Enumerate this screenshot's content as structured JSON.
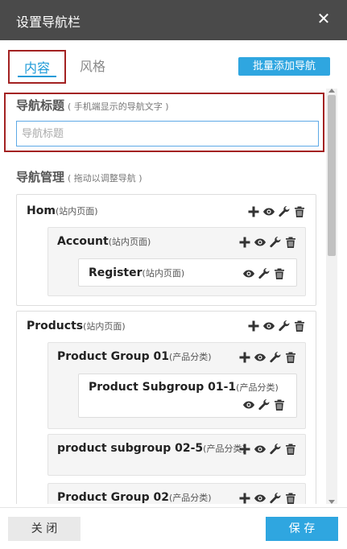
{
  "dialog": {
    "title": "设置导航栏",
    "close_glyph": "✕"
  },
  "tabs": [
    {
      "label": "内容",
      "active": true
    },
    {
      "label": "风格",
      "active": false
    }
  ],
  "batch_add_label": "批量添加导航",
  "nav_title": {
    "label": "导航标题",
    "hint": "( 手机端显示的导航文字 )",
    "placeholder": "导航标题",
    "value": ""
  },
  "nav_manage": {
    "label": "导航管理",
    "hint": "( 拖动以调整导航 )"
  },
  "nav_items": {
    "hom": {
      "name": "Hom",
      "type": "(站内页面)"
    },
    "account": {
      "name": "Account",
      "type": "(站内页面)"
    },
    "register": {
      "name": "Register",
      "type": "(站内页面)"
    },
    "products": {
      "name": "Products",
      "type": "(站内页面)"
    },
    "product_group_01": {
      "name": "Product Group 01",
      "type": "(产品分类)"
    },
    "product_subgroup_01_1": {
      "name": "Product Subgroup 01-1",
      "type": "(产品分类)"
    },
    "product_subgroup_02_5": {
      "name": "product subgroup 02-5",
      "type": "(产品分类)"
    },
    "product_group_02": {
      "name": "Product Group 02",
      "type": "(产品分类)"
    }
  },
  "icons": [
    "plus-icon",
    "eye-icon",
    "wrench-icon",
    "trash-icon",
    "close-icon"
  ],
  "footer": {
    "close_label": "关 闭",
    "save_label": "保 存"
  },
  "colors": {
    "titlebar": "#4a4a4a",
    "accent": "#2fa6e0",
    "highlight_border": "#a32222",
    "input_border": "#5ea9e6"
  }
}
